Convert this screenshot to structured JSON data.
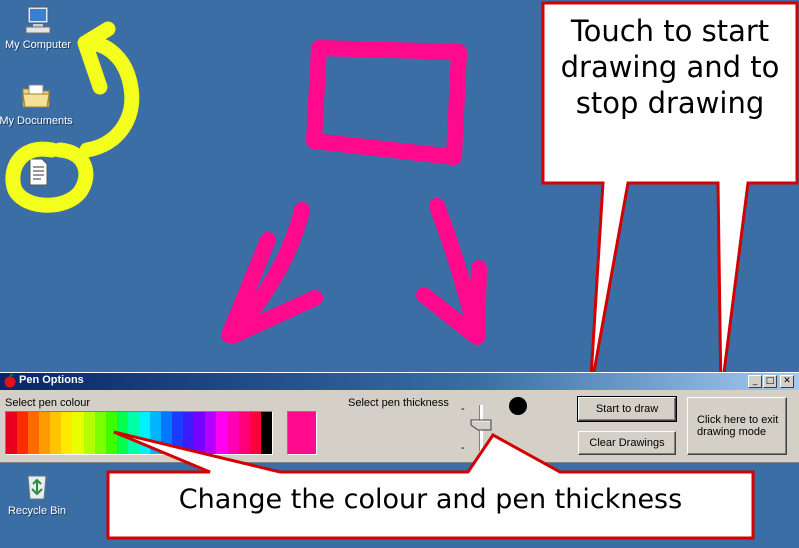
{
  "desktop": {
    "icons": [
      {
        "label": "My Computer",
        "icon": "computer-icon"
      },
      {
        "label": "My Documents",
        "icon": "documents-folder-icon"
      },
      {
        "label": "",
        "icon": "document-file-icon"
      },
      {
        "label": "Recycle Bin",
        "icon": "recycle-bin-icon"
      }
    ],
    "background_color": "#3a6ea5"
  },
  "drawing_colors": {
    "pink": "#ff0a8c",
    "yellow": "#f5ff1c"
  },
  "callouts": {
    "top": {
      "line1": "Touch to start",
      "line2": "drawing and to",
      "line3": "stop drawing"
    },
    "bottom": {
      "text": "Change the colour and pen thickness"
    },
    "border_color": "#d40000"
  },
  "pen_window": {
    "title": "Pen Options",
    "controls": {
      "minimize": "_",
      "maximize": "□",
      "close": "✕"
    },
    "select_colour_label": "Select pen colour",
    "select_thickness_label": "Select pen thickness",
    "palette": [
      "#e8001e",
      "#ff2b00",
      "#ff6a00",
      "#ff9a00",
      "#ffc400",
      "#ffe800",
      "#e8ff00",
      "#b4ff00",
      "#7cff00",
      "#3cff00",
      "#00ff50",
      "#00ffa8",
      "#00f0ff",
      "#00b4ff",
      "#0078ff",
      "#1c3cff",
      "#3c1cff",
      "#7800ff",
      "#b400ff",
      "#ff00f0",
      "#ff00b4",
      "#ff0078",
      "#ff003c",
      "#000000"
    ],
    "selected_colour": "#ff0a8c",
    "slider_minus_top": "-",
    "slider_minus_bottom": "-",
    "start_button": "Start to draw",
    "clear_button": "Clear Drawings",
    "exit_button_line1": "Click here to exit",
    "exit_button_line2": "drawing mode"
  }
}
